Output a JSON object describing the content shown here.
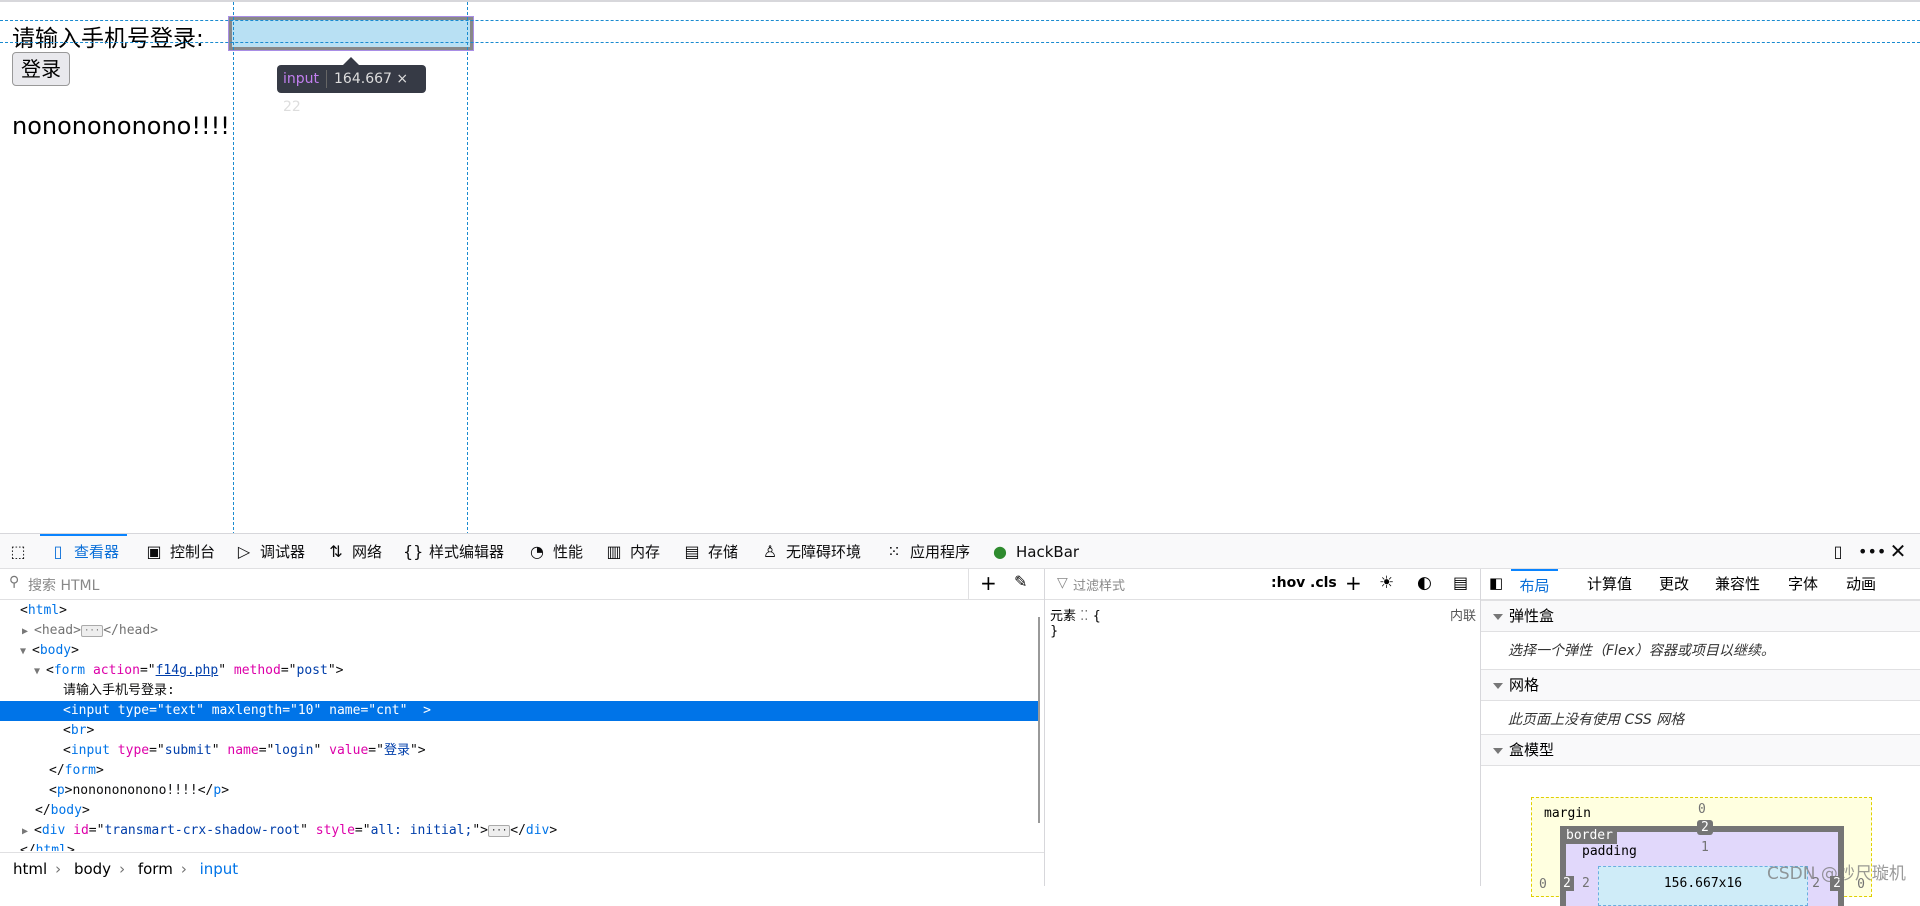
{
  "page": {
    "label": "请输入手机号登录:",
    "login_button": "登录",
    "message": "nononononono!!!!"
  },
  "tooltip": {
    "tag": "input",
    "size": "164.667 × 22"
  },
  "toolbar": {
    "tabs": [
      {
        "label": "查看器",
        "icon": "inspector-icon"
      },
      {
        "label": "控制台",
        "icon": "console-icon"
      },
      {
        "label": "调试器",
        "icon": "debugger-icon"
      },
      {
        "label": "网络",
        "icon": "network-icon"
      },
      {
        "label": "样式编辑器",
        "icon": "style-editor-icon"
      },
      {
        "label": "性能",
        "icon": "performance-icon"
      },
      {
        "label": "内存",
        "icon": "memory-icon"
      },
      {
        "label": "存储",
        "icon": "storage-icon"
      },
      {
        "label": "无障碍环境",
        "icon": "accessibility-icon"
      },
      {
        "label": "应用程序",
        "icon": "application-icon"
      },
      {
        "label": "HackBar",
        "icon": "hackbar-icon"
      }
    ],
    "selected": "查看器"
  },
  "inspector": {
    "search_placeholder": "搜索 HTML",
    "tree": {
      "html": "html",
      "head": "head",
      "body": "body",
      "form": "form",
      "action_attr": "action",
      "action_val": "f14g.php",
      "method_attr": "method",
      "method_val": "post",
      "text": "请输入手机号登录:",
      "input": "input",
      "type_attr": "type",
      "text_val": "text",
      "maxlength_attr": "maxlength",
      "maxlength_val": "10",
      "name_attr": "name",
      "cnt_val": "cnt",
      "br": "br",
      "submit_val": "submit",
      "login_val": "login",
      "value_attr": "value",
      "value_val": "登录",
      "p": "p",
      "p_text": "nononononono!!!!",
      "div": "div",
      "id_attr": "id",
      "id_val": "transmart-crx-shadow-root",
      "style_attr": "style",
      "style_val": "all: initial;"
    },
    "breadcrumb": [
      "html",
      "body",
      "form",
      "input"
    ]
  },
  "rules": {
    "filter_placeholder": "过滤样式",
    "hov": ":hov",
    "cls": ".cls",
    "element_label": "元素",
    "open_brace": "{",
    "close_brace": "}",
    "inline": "内联"
  },
  "layout": {
    "tabs": [
      "布局",
      "计算值",
      "更改",
      "兼容性",
      "字体",
      "动画"
    ],
    "selected": "布局",
    "flex_title": "弹性盒",
    "flex_note": "选择一个弹性（Flex）容器或项目以继续。",
    "grid_title": "网格",
    "grid_note": "此页面上没有使用 CSS 网格",
    "box_title": "盒模型",
    "box": {
      "margin_label": "margin",
      "margin_top": "0",
      "margin_left": "0",
      "margin_right": "0",
      "border_label": "border",
      "border_top": "2",
      "border_left": "2",
      "border_right": "2",
      "padding_label": "padding",
      "padding_top": "1",
      "padding_left": "2",
      "padding_right": "2",
      "content": "156.667x16"
    }
  },
  "watermark": "CSDN @妙尺璇机"
}
